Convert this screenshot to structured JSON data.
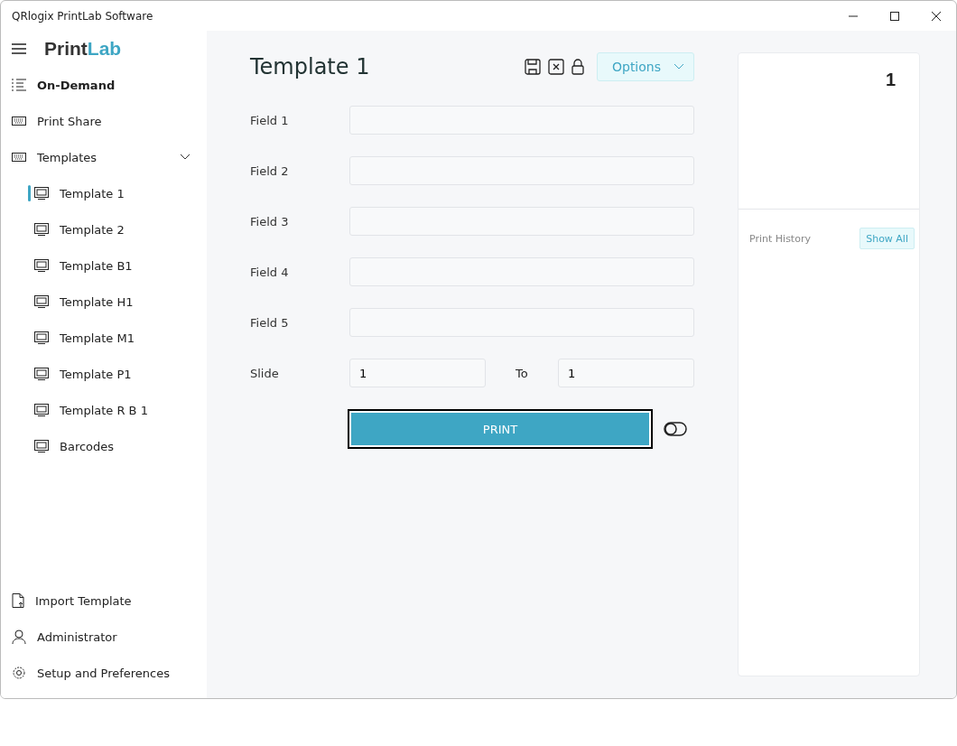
{
  "window": {
    "title": "QRlogix PrintLab Software"
  },
  "logo": {
    "dark": "Print",
    "accent": "Lab"
  },
  "nav": [
    {
      "label": "On-Demand",
      "kind": "list",
      "selected": true
    },
    {
      "label": "Print Share",
      "kind": "keyboard",
      "selected": false
    },
    {
      "label": "Templates",
      "kind": "keyboard",
      "selected": false,
      "expanded": true,
      "children": [
        {
          "label": "Template 1",
          "selected": true
        },
        {
          "label": "Template 2",
          "selected": false
        },
        {
          "label": "Template B1",
          "selected": false
        },
        {
          "label": "Template H1",
          "selected": false
        },
        {
          "label": "Template M1",
          "selected": false
        },
        {
          "label": "Template P1",
          "selected": false
        },
        {
          "label": "Template R B 1",
          "selected": false
        },
        {
          "label": "Barcodes",
          "selected": false
        }
      ]
    }
  ],
  "footer_nav": [
    {
      "label": "Import Template",
      "kind": "file"
    },
    {
      "label": "Administrator",
      "kind": "person"
    },
    {
      "label": "Setup and Preferences",
      "kind": "gear"
    }
  ],
  "form": {
    "title": "Template 1",
    "options_button": "Options",
    "fields": [
      {
        "label": "Field 1"
      },
      {
        "label": "Field 2"
      },
      {
        "label": "Field 3"
      },
      {
        "label": "Field 4"
      },
      {
        "label": "Field 5"
      }
    ],
    "slide": {
      "label": "Slide",
      "from": "1",
      "to_label": "To",
      "to": "1"
    },
    "print_button": "PRINT",
    "toggle_on": false
  },
  "preview": {
    "count": "1",
    "history_label": "Print History",
    "show_all_button": "Show All"
  }
}
